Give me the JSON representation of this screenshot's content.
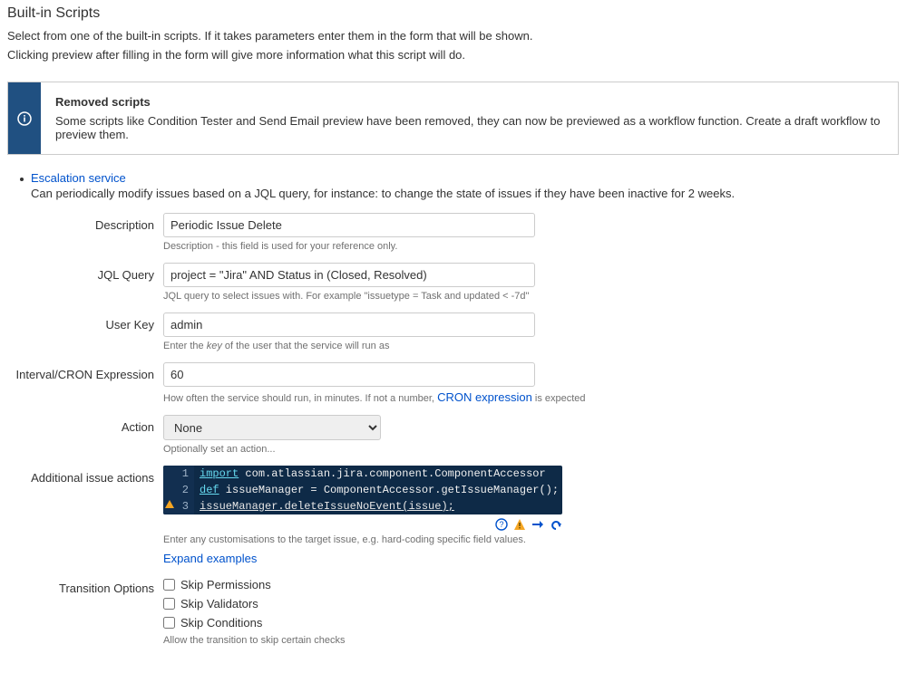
{
  "page": {
    "title": "Built-in Scripts",
    "intro1": "Select from one of the built-in scripts. If it takes parameters enter them in the form that will be shown.",
    "intro2": "Clicking preview after filling in the form will give more information what this script will do."
  },
  "banner": {
    "title": "Removed scripts",
    "message": "Some scripts like Condition Tester and Send Email preview have been removed, they can now be previewed as a workflow function. Create a draft workflow to preview them."
  },
  "script": {
    "link_text": "Escalation service",
    "description": "Can periodically modify issues based on a JQL query, for instance: to change the state of issues if they have been inactive for 2 weeks."
  },
  "form": {
    "description": {
      "label": "Description",
      "value": "Periodic Issue Delete",
      "help": "Description - this field is used for your reference only."
    },
    "jql": {
      "label": "JQL Query",
      "value": "project = \"Jira\" AND Status in (Closed, Resolved)",
      "help": "JQL query to select issues with. For example \"issuetype = Task and updated < -7d\""
    },
    "userkey": {
      "label": "User Key",
      "value": "admin",
      "help_pre": "Enter the ",
      "help_em": "key",
      "help_post": " of the user that the service will run as"
    },
    "interval": {
      "label": "Interval/CRON Expression",
      "value": "60",
      "help_pre": "How often the service should run, in minutes. If not a number, ",
      "help_link": "CRON expression",
      "help_post": " is expected"
    },
    "action": {
      "label": "Action",
      "value": "None",
      "help": "Optionally set an action..."
    },
    "additional": {
      "label": "Additional issue actions",
      "help": "Enter any customisations to the target issue, e.g. hard-coding specific field values.",
      "expand_link": "Expand examples",
      "code": {
        "line1_num": "1",
        "line1": "import com.atlassian.jira.component.ComponentAccessor",
        "line2_num": "2",
        "line2_kw": "def",
        "line2_rest": " issueManager = ComponentAccessor.getIssueManager();",
        "line3_num": "3",
        "line3": "issueManager.deleteIssueNoEvent(issue);"
      }
    },
    "transition": {
      "label": "Transition Options",
      "skip_permissions": "Skip Permissions",
      "skip_validators": "Skip Validators",
      "skip_conditions": "Skip Conditions",
      "help": "Allow the transition to skip certain checks"
    }
  }
}
